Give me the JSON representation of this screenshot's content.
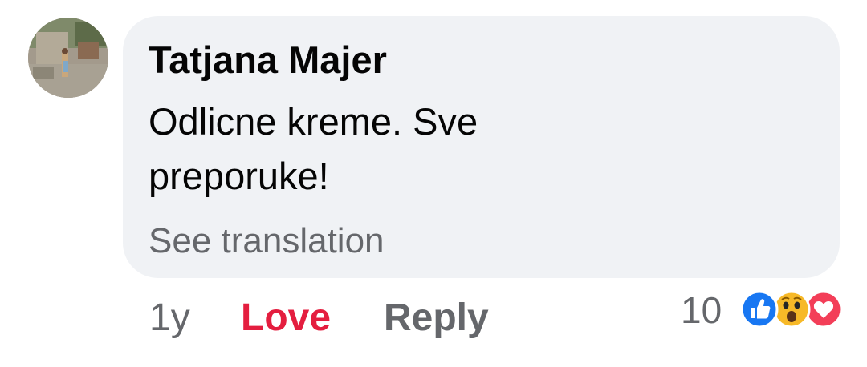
{
  "comment": {
    "author": "Tatjana Majer",
    "text": "Odlicne kreme. Sve preporuke!",
    "see_translation": "See translation"
  },
  "actions": {
    "time": "1y",
    "love_label": "Love",
    "reply_label": "Reply"
  },
  "reactions": {
    "count": "10",
    "icons": [
      "like-icon",
      "wow-icon",
      "love-icon"
    ]
  },
  "colors": {
    "bubble_bg": "#f0f2f5",
    "love_red": "#e41e3f",
    "secondary_text": "#65676b",
    "like_blue": "#1877f2",
    "wow_yellow": "#f7b928"
  }
}
